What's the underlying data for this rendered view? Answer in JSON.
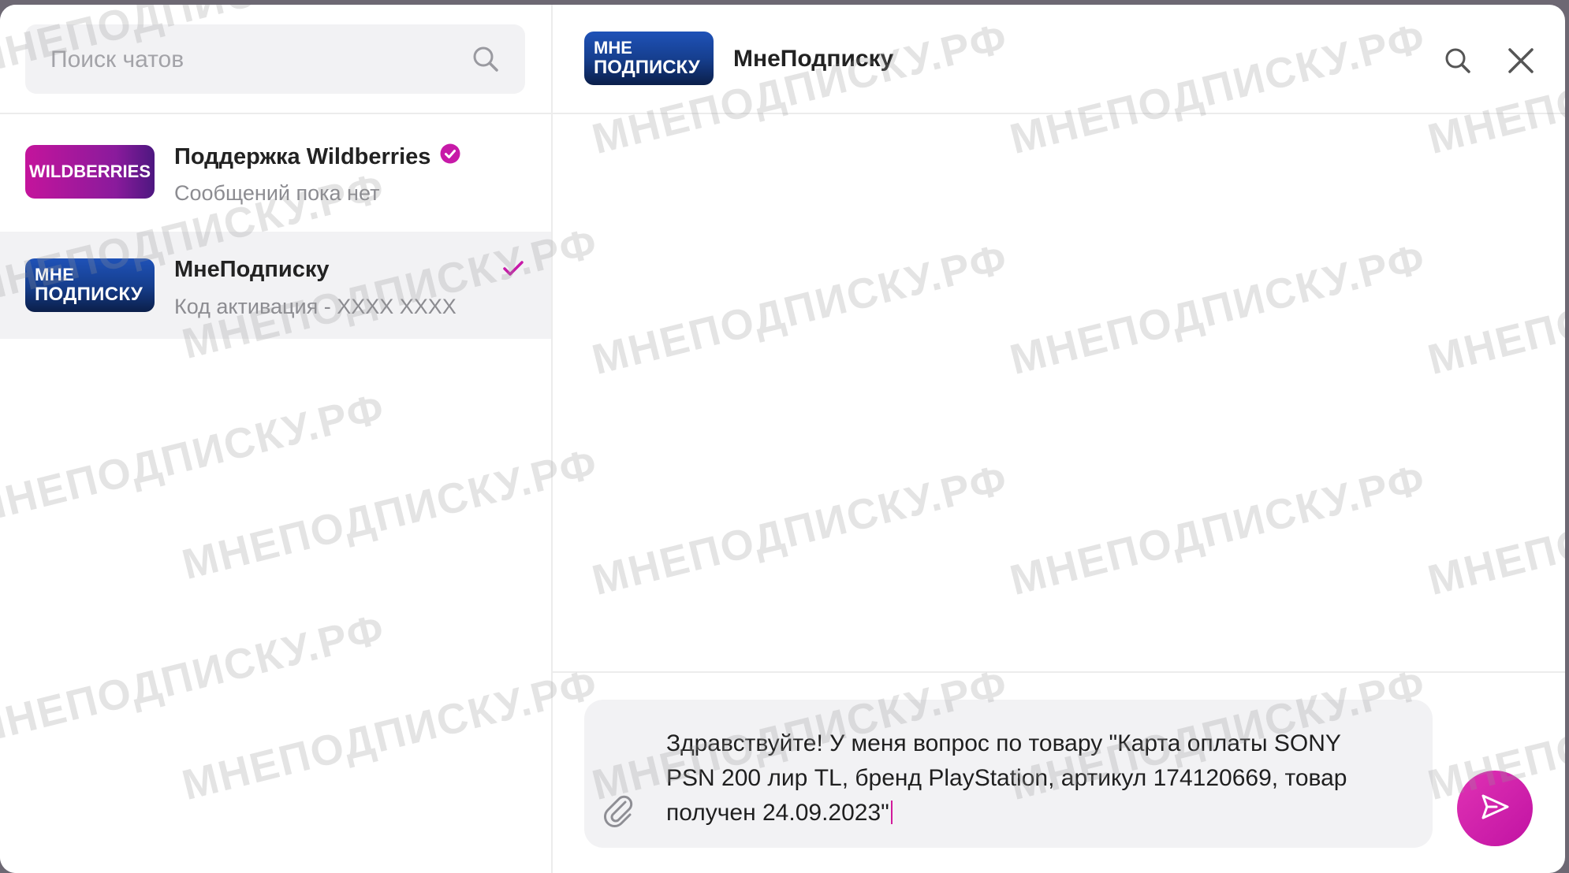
{
  "search": {
    "placeholder": "Поиск чатов"
  },
  "chats": [
    {
      "avatar_text": "WILDBERRIES",
      "name": "Поддержка Wildberries",
      "verified": true,
      "preview": "Сообщений пока нет"
    },
    {
      "avatar_line1": "МНЕ",
      "avatar_line2": "ПОДПИСКУ",
      "name": "МнеПодписку",
      "preview": "Код активация - XXXX XXXX",
      "read_status": "check"
    }
  ],
  "conversation": {
    "avatar_line1": "МНЕ",
    "avatar_line2": "ПОДПИСКУ",
    "title": "МнеПодписку"
  },
  "composer": {
    "message": "Здравствуйте! У меня вопрос по товару \"Карта оплаты SONY PSN 200 лир TL, бренд PlayStation, артикул 174120669, товар получен 24.09.2023\""
  },
  "watermark": {
    "text": "МНЕПОДПИСКУ.РФ"
  },
  "colors": {
    "accent": "#c71aa8",
    "wildberries_brand": "#a3169f",
    "mnepodpisku_brand": "#163f8f",
    "panel_bg": "#f2f2f4"
  },
  "icons": {
    "search": "search-icon",
    "close": "close-icon",
    "attach": "paperclip-icon",
    "send": "send-icon",
    "verified": "verified-badge-icon",
    "read": "checkmark-icon"
  }
}
